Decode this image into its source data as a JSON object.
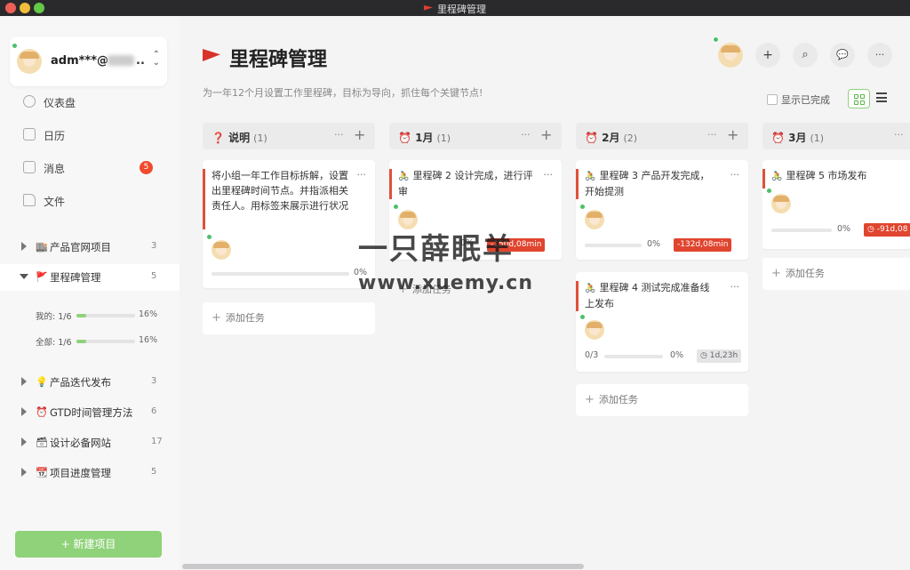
{
  "window": {
    "title": "里程碑管理"
  },
  "user": {
    "name": "adm***@",
    "ellipsis": ".."
  },
  "nav": [
    {
      "label": "仪表盘",
      "icon": "dashboard-icon"
    },
    {
      "label": "日历",
      "icon": "calendar-icon"
    },
    {
      "label": "消息",
      "icon": "message-icon",
      "badge": "5"
    },
    {
      "label": "文件",
      "icon": "file-icon"
    }
  ],
  "projects": [
    {
      "emoji": "🏬",
      "label": "产品官网项目",
      "count": "3"
    },
    {
      "emoji": "🚩",
      "label": "里程碑管理",
      "count": "5"
    },
    {
      "emoji": "💡",
      "label": "产品迭代发布",
      "count": "3"
    },
    {
      "emoji": "⏰",
      "label": "GTD时间管理方法",
      "count": "6"
    },
    {
      "emoji": "🗃",
      "label": "设计必备网站",
      "count": "17"
    },
    {
      "emoji": "📆",
      "label": "项目进度管理",
      "count": "5"
    }
  ],
  "progress": {
    "mine": {
      "label": "我的: 1/6",
      "pct": "16%",
      "value": 0.16
    },
    "all": {
      "label": "全部: 1/6",
      "pct": "16%",
      "value": 0.16
    }
  },
  "new_project": "+ 新建项目",
  "page": {
    "title": "里程碑管理",
    "desc": "为一年12个月设置工作里程碑，目标为导向，抓住每个关键节点!",
    "show_done": "显示已完成"
  },
  "header_buttons": {
    "add": "+",
    "search": "⌕",
    "chat": "💬",
    "more": "···"
  },
  "columns": [
    {
      "icon": "❓",
      "title": "说明",
      "count": "(1)"
    },
    {
      "icon": "⏰",
      "title": "1月",
      "count": "(1)"
    },
    {
      "icon": "⏰",
      "title": "2月",
      "count": "(2)"
    },
    {
      "icon": "⏰",
      "title": "3月",
      "count": "(1)"
    }
  ],
  "cards": {
    "c0": {
      "text": "将小组一年工作目标拆解，设置出里程碑时间节点。并指派相关责任人。用标签来展示进行状况",
      "pct": "0%",
      "value": 0
    },
    "c1": {
      "text": "里程碑 2 设计完成，进行评审",
      "pct": "0%",
      "due": "-150d,08min",
      "value": 0
    },
    "c2a": {
      "text": "里程碑 3 产品开发完成，开始提测",
      "pct": "0%",
      "due": "-132d,08min",
      "value": 0
    },
    "c2b": {
      "text": "里程碑 4 测试完成准备线上发布",
      "sub": "0/3",
      "pct": "0%",
      "due": "1d,23h",
      "value": 0
    },
    "c3": {
      "text": "里程碑 5 市场发布",
      "pct": "0%",
      "due": "-91d,08"
    }
  },
  "add_task": "添加任务",
  "watermark": {
    "line1": "一只薛眠羊",
    "line2": "www.xuemy.cn"
  },
  "colors": {
    "accent": "#e0503a",
    "green": "#8fd27a",
    "due_red": "#e0452f"
  }
}
